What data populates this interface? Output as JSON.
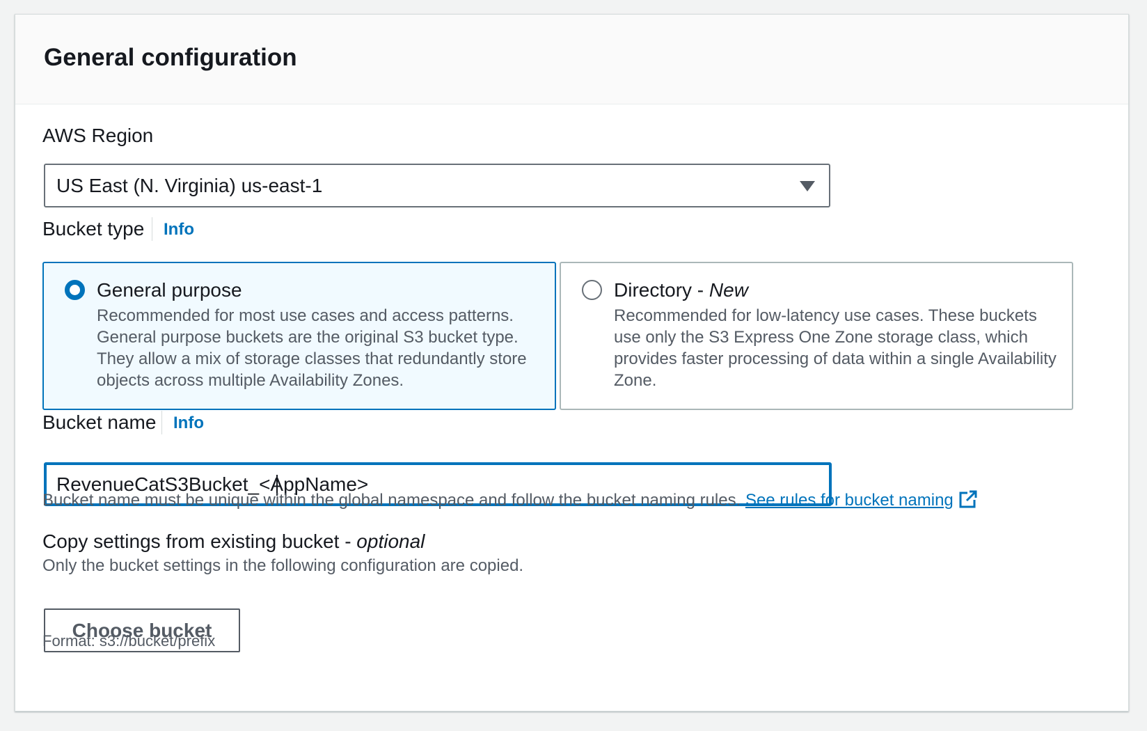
{
  "panel": {
    "title": "General configuration"
  },
  "region": {
    "label": "AWS Region",
    "value": "US East (N. Virginia) us-east-1"
  },
  "bucket_type": {
    "label": "Bucket type",
    "info": "Info",
    "options": [
      {
        "title": "General purpose",
        "title_suffix": "",
        "selected": true,
        "description": "Recommended for most use cases and access patterns. General purpose buckets are the original S3 bucket type. They allow a mix of storage classes that redundantly store objects across multiple Availability Zones."
      },
      {
        "title": "Directory - ",
        "title_suffix": "New",
        "selected": false,
        "description": "Recommended for low-latency use cases. These buckets use only the S3 Express One Zone storage class, which provides faster processing of data within a single Availability Zone."
      }
    ]
  },
  "bucket_name": {
    "label": "Bucket name",
    "info": "Info",
    "value": "RevenueCatS3Bucket_<AppName>",
    "hint": "Bucket name must be unique within the global namespace and follow the bucket naming rules.",
    "link": "See rules for bucket naming"
  },
  "copy_settings": {
    "label": "Copy settings from existing bucket - ",
    "label_suffix": "optional",
    "description": "Only the bucket settings in the following configuration are copied.",
    "button": "Choose bucket",
    "format_hint": "Format: s3://bucket/prefix"
  },
  "colors": {
    "accent": "#0073bb",
    "text": "#16191f",
    "muted": "#545b64"
  }
}
